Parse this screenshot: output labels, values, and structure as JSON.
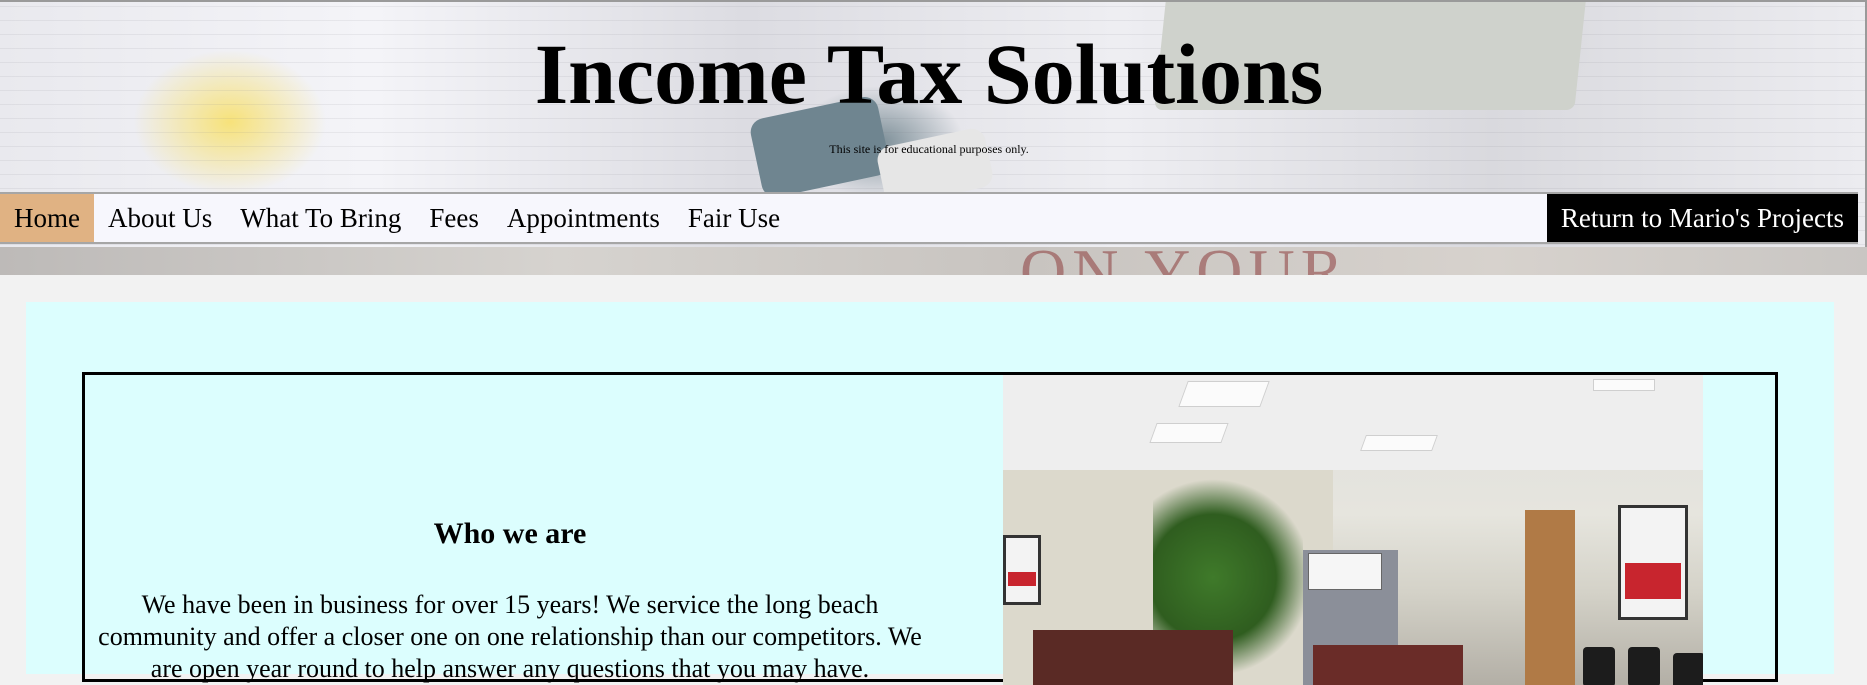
{
  "header": {
    "title": "Income Tax Solutions",
    "subtitle": "This site is for educational purposes only."
  },
  "nav": {
    "items": [
      {
        "label": "Home",
        "active": true
      },
      {
        "label": "About Us"
      },
      {
        "label": "What To Bring"
      },
      {
        "label": "Fees"
      },
      {
        "label": "Appointments"
      },
      {
        "label": "Fair Use"
      }
    ],
    "right_button": "Return to Mario's Projects"
  },
  "colors": {
    "nav_active": "#e0b283",
    "main_background": "#dcfefe",
    "right_button_bg": "#000000"
  },
  "main": {
    "heading": "Who we are",
    "paragraph": "We have been in business for over 15 years! We service the long beach community and offer a closer one on one relationship than our competitors. We are open year round to help answer any questions that you may have."
  },
  "banner_background_text": "ON YOUR"
}
